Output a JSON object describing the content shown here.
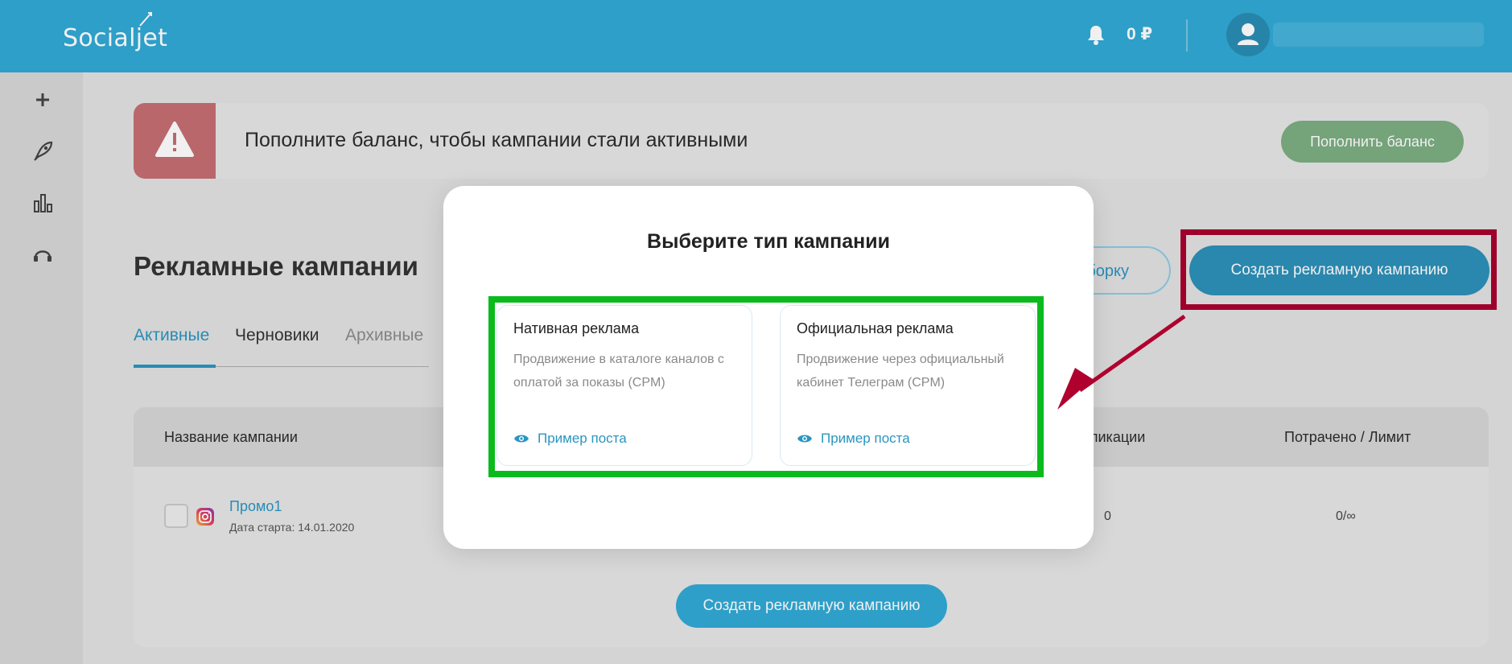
{
  "header": {
    "logo": "Socialjet",
    "balance": "0 ₽"
  },
  "sidebar": {
    "items": [
      {
        "icon": "plus-icon"
      },
      {
        "icon": "rocket-icon"
      },
      {
        "icon": "bar-chart-icon"
      },
      {
        "icon": "support-headset-icon"
      }
    ]
  },
  "banner": {
    "text": "Пополните баланс, чтобы кампании стали активными",
    "button": "Пополнить баланс"
  },
  "page": {
    "title": "Рекламные кампании",
    "tabs": [
      {
        "label": "Активные"
      },
      {
        "label": "Черновики"
      },
      {
        "label": "Архивные"
      }
    ],
    "outline_button": "борку",
    "create_button": "Создать рекламную кампанию"
  },
  "table": {
    "columns": [
      {
        "label": "Название кампании"
      },
      {
        "label": "ликации"
      },
      {
        "label": "Потрачено / Лимит"
      }
    ],
    "rows": [
      {
        "name": "Промо1",
        "date": "Дата старта: 14.01.2020",
        "col_a": "0",
        "col_b": "0/∞"
      }
    ],
    "create_button": "Создать рекламную кампанию"
  },
  "modal": {
    "title": "Выберите тип кампании",
    "cards": [
      {
        "title": "Нативная реклама",
        "description": "Продвижение в каталоге каналов с оплатой за показы (CPM)",
        "link": "Пример поста"
      },
      {
        "title": "Официальная реклама",
        "description": "Продвижение через официальный кабинет Телеграм (CPM)",
        "link": "Пример поста"
      }
    ]
  },
  "colors": {
    "header": "#31a9d5",
    "accent": "#2a95c1",
    "warning": "#c56e72",
    "balance_button": "#7dae82",
    "highlight_red": "#a8002e",
    "highlight_green": "#0bbb1e"
  }
}
